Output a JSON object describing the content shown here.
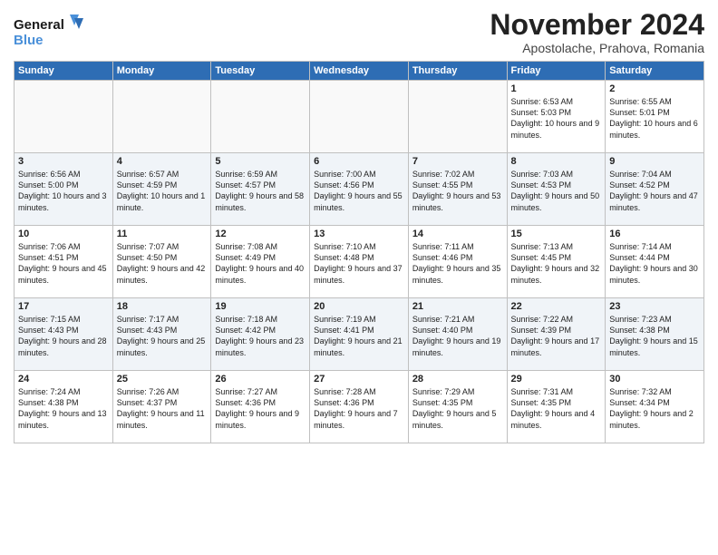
{
  "logo": {
    "line1": "General",
    "line2": "Blue"
  },
  "title": "November 2024",
  "subtitle": "Apostolache, Prahova, Romania",
  "days_header": [
    "Sunday",
    "Monday",
    "Tuesday",
    "Wednesday",
    "Thursday",
    "Friday",
    "Saturday"
  ],
  "weeks": [
    [
      {
        "day": "",
        "info": ""
      },
      {
        "day": "",
        "info": ""
      },
      {
        "day": "",
        "info": ""
      },
      {
        "day": "",
        "info": ""
      },
      {
        "day": "",
        "info": ""
      },
      {
        "day": "1",
        "info": "Sunrise: 6:53 AM\nSunset: 5:03 PM\nDaylight: 10 hours and 9 minutes."
      },
      {
        "day": "2",
        "info": "Sunrise: 6:55 AM\nSunset: 5:01 PM\nDaylight: 10 hours and 6 minutes."
      }
    ],
    [
      {
        "day": "3",
        "info": "Sunrise: 6:56 AM\nSunset: 5:00 PM\nDaylight: 10 hours and 3 minutes."
      },
      {
        "day": "4",
        "info": "Sunrise: 6:57 AM\nSunset: 4:59 PM\nDaylight: 10 hours and 1 minute."
      },
      {
        "day": "5",
        "info": "Sunrise: 6:59 AM\nSunset: 4:57 PM\nDaylight: 9 hours and 58 minutes."
      },
      {
        "day": "6",
        "info": "Sunrise: 7:00 AM\nSunset: 4:56 PM\nDaylight: 9 hours and 55 minutes."
      },
      {
        "day": "7",
        "info": "Sunrise: 7:02 AM\nSunset: 4:55 PM\nDaylight: 9 hours and 53 minutes."
      },
      {
        "day": "8",
        "info": "Sunrise: 7:03 AM\nSunset: 4:53 PM\nDaylight: 9 hours and 50 minutes."
      },
      {
        "day": "9",
        "info": "Sunrise: 7:04 AM\nSunset: 4:52 PM\nDaylight: 9 hours and 47 minutes."
      }
    ],
    [
      {
        "day": "10",
        "info": "Sunrise: 7:06 AM\nSunset: 4:51 PM\nDaylight: 9 hours and 45 minutes."
      },
      {
        "day": "11",
        "info": "Sunrise: 7:07 AM\nSunset: 4:50 PM\nDaylight: 9 hours and 42 minutes."
      },
      {
        "day": "12",
        "info": "Sunrise: 7:08 AM\nSunset: 4:49 PM\nDaylight: 9 hours and 40 minutes."
      },
      {
        "day": "13",
        "info": "Sunrise: 7:10 AM\nSunset: 4:48 PM\nDaylight: 9 hours and 37 minutes."
      },
      {
        "day": "14",
        "info": "Sunrise: 7:11 AM\nSunset: 4:46 PM\nDaylight: 9 hours and 35 minutes."
      },
      {
        "day": "15",
        "info": "Sunrise: 7:13 AM\nSunset: 4:45 PM\nDaylight: 9 hours and 32 minutes."
      },
      {
        "day": "16",
        "info": "Sunrise: 7:14 AM\nSunset: 4:44 PM\nDaylight: 9 hours and 30 minutes."
      }
    ],
    [
      {
        "day": "17",
        "info": "Sunrise: 7:15 AM\nSunset: 4:43 PM\nDaylight: 9 hours and 28 minutes."
      },
      {
        "day": "18",
        "info": "Sunrise: 7:17 AM\nSunset: 4:43 PM\nDaylight: 9 hours and 25 minutes."
      },
      {
        "day": "19",
        "info": "Sunrise: 7:18 AM\nSunset: 4:42 PM\nDaylight: 9 hours and 23 minutes."
      },
      {
        "day": "20",
        "info": "Sunrise: 7:19 AM\nSunset: 4:41 PM\nDaylight: 9 hours and 21 minutes."
      },
      {
        "day": "21",
        "info": "Sunrise: 7:21 AM\nSunset: 4:40 PM\nDaylight: 9 hours and 19 minutes."
      },
      {
        "day": "22",
        "info": "Sunrise: 7:22 AM\nSunset: 4:39 PM\nDaylight: 9 hours and 17 minutes."
      },
      {
        "day": "23",
        "info": "Sunrise: 7:23 AM\nSunset: 4:38 PM\nDaylight: 9 hours and 15 minutes."
      }
    ],
    [
      {
        "day": "24",
        "info": "Sunrise: 7:24 AM\nSunset: 4:38 PM\nDaylight: 9 hours and 13 minutes."
      },
      {
        "day": "25",
        "info": "Sunrise: 7:26 AM\nSunset: 4:37 PM\nDaylight: 9 hours and 11 minutes."
      },
      {
        "day": "26",
        "info": "Sunrise: 7:27 AM\nSunset: 4:36 PM\nDaylight: 9 hours and 9 minutes."
      },
      {
        "day": "27",
        "info": "Sunrise: 7:28 AM\nSunset: 4:36 PM\nDaylight: 9 hours and 7 minutes."
      },
      {
        "day": "28",
        "info": "Sunrise: 7:29 AM\nSunset: 4:35 PM\nDaylight: 9 hours and 5 minutes."
      },
      {
        "day": "29",
        "info": "Sunrise: 7:31 AM\nSunset: 4:35 PM\nDaylight: 9 hours and 4 minutes."
      },
      {
        "day": "30",
        "info": "Sunrise: 7:32 AM\nSunset: 4:34 PM\nDaylight: 9 hours and 2 minutes."
      }
    ]
  ]
}
